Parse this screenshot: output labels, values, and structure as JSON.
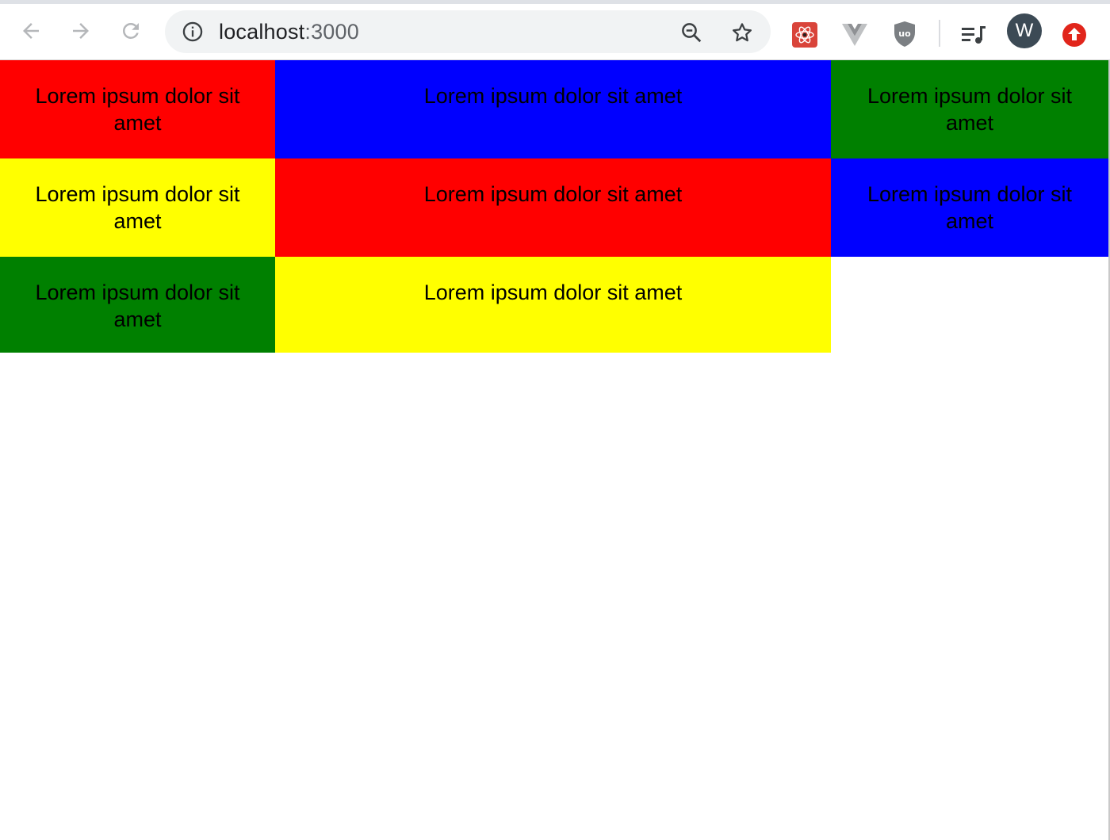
{
  "browser": {
    "url_host": "localhost",
    "url_port": ":3000",
    "profile_initial": "W",
    "icons": {
      "back": "arrow-left-icon",
      "forward": "arrow-right-icon",
      "reload": "reload-icon",
      "site_info": "info-icon",
      "zoom": "zoom-out-icon",
      "bookmark": "star-icon",
      "extension_react": "react-devtools-icon",
      "extension_vue": "vue-devtools-icon",
      "extension_ublock": "ublock-shield-icon",
      "media": "media-playlist-icon",
      "update": "update-arrow-icon"
    },
    "colors": {
      "update_badge": "#e1251b",
      "avatar": "#3c4a55"
    }
  },
  "page": {
    "cells": [
      {
        "text": "Lorem ipsum dolor sit amet",
        "color": "#ff0000"
      },
      {
        "text": "Lorem ipsum dolor sit amet",
        "color": "#0000ff"
      },
      {
        "text": "Lorem ipsum dolor sit amet",
        "color": "#008000"
      },
      {
        "text": "Lorem ipsum dolor sit amet",
        "color": "#ffff00"
      },
      {
        "text": "Lorem ipsum dolor sit amet",
        "color": "#ff0000"
      },
      {
        "text": "Lorem ipsum dolor sit amet",
        "color": "#0000ff"
      },
      {
        "text": "Lorem ipsum dolor sit amet",
        "color": "#008000"
      },
      {
        "text": "Lorem ipsum dolor sit amet",
        "color": "#ffff00"
      }
    ]
  }
}
